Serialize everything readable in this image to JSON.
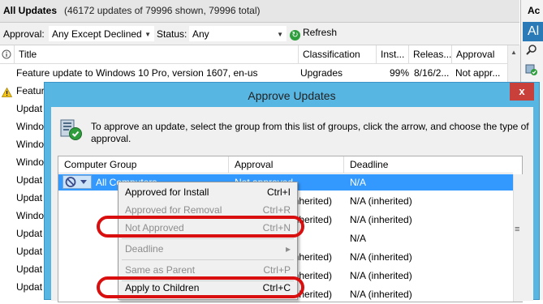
{
  "window": {
    "title": "All Updates",
    "count_text": "(46172 updates of 79996 shown, 79996 total)"
  },
  "filters": {
    "approval_label": "Approval:",
    "approval_value": "Any Except Declined",
    "status_label": "Status:",
    "status_value": "Any",
    "refresh_label": "Refresh"
  },
  "table": {
    "columns": [
      "Title",
      "Classification",
      "Inst...",
      "Releas...",
      "Approval"
    ],
    "rows": [
      {
        "title": "Feature update to Windows 10 Pro, version 1607, en-us",
        "classification": "Upgrades",
        "installed": "99%",
        "release": "8/16/2...",
        "approval": "Not appr..."
      },
      {
        "title": "Featur"
      },
      {
        "title": "Updat"
      },
      {
        "title": "Windo"
      },
      {
        "title": "Windo"
      },
      {
        "title": "Windo"
      },
      {
        "title": "Updat"
      },
      {
        "title": "Updat"
      },
      {
        "title": "Windo"
      },
      {
        "title": "Updat"
      },
      {
        "title": "Updat"
      },
      {
        "title": "Updat"
      },
      {
        "title": "Updat"
      }
    ]
  },
  "actions_pane": {
    "header": "Ac",
    "selected": "Al"
  },
  "dialog": {
    "title": "Approve Updates",
    "close": "x",
    "instruction": "To approve an update, select the group from this list of groups, click the arrow, and choose the type of approval.",
    "grid_headers": [
      "Computer Group",
      "Approval",
      "Deadline"
    ],
    "rows": [
      {
        "group": "All Computers",
        "approval": "Not approved",
        "deadline": "N/A"
      },
      {
        "group": "",
        "approval": "(inherited)",
        "deadline": "N/A (inherited)"
      },
      {
        "group": "",
        "approval": "(inherited)",
        "deadline": "N/A (inherited)"
      },
      {
        "group": "",
        "approval": "",
        "deadline": "N/A"
      },
      {
        "group": "",
        "approval": "(inherited)",
        "deadline": "N/A (inherited)"
      },
      {
        "group": "",
        "approval": "(inherited)",
        "deadline": "N/A (inherited)"
      },
      {
        "group": "",
        "approval": "(inherited)",
        "deadline": "N/A (inherited)"
      }
    ]
  },
  "context_menu": {
    "items": [
      {
        "label": "Approved for Install",
        "shortcut": "Ctrl+I",
        "enabled": true
      },
      {
        "label": "Approved for Removal",
        "shortcut": "Ctrl+R",
        "enabled": false
      },
      {
        "label": "Not Approved",
        "shortcut": "Ctrl+N",
        "enabled": false
      },
      {
        "label": "Deadline",
        "shortcut": "",
        "enabled": false,
        "submenu": true
      },
      {
        "label": "Same as Parent",
        "shortcut": "Ctrl+P",
        "enabled": false
      },
      {
        "label": "Apply to Children",
        "shortcut": "Ctrl+C",
        "enabled": true
      }
    ],
    "submenu_arrow": "▸"
  },
  "colors": {
    "dialog_frame": "#58b6e3",
    "selection": "#3399ff",
    "highlight_oval": "#d90e0e",
    "close_button": "#c9403a"
  }
}
